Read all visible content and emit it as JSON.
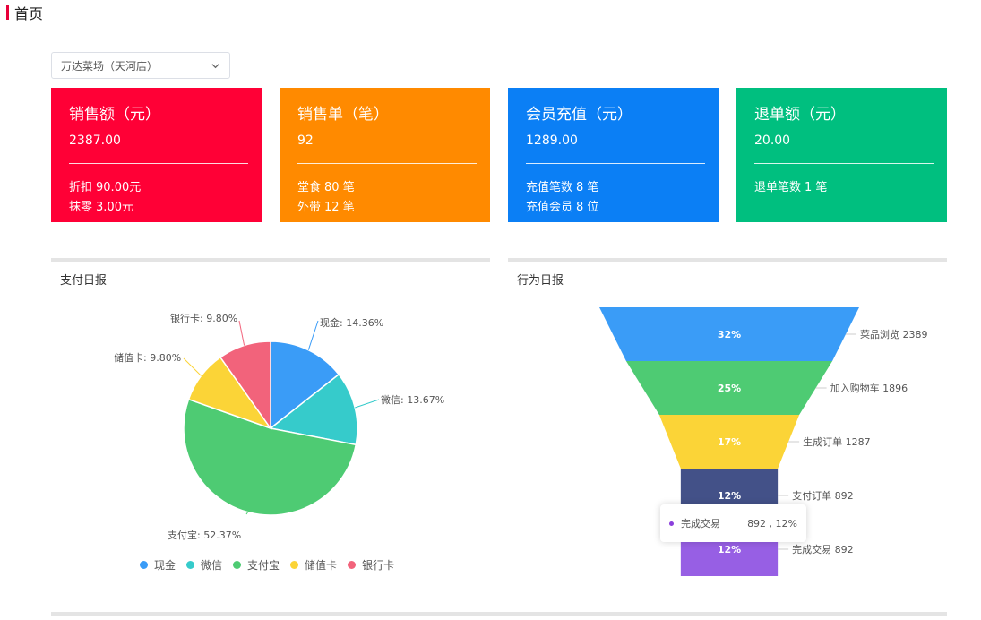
{
  "header": {
    "title": "首页"
  },
  "store_select": {
    "value": "万达菜场（天河店）",
    "icon": "chevron-down-icon"
  },
  "cards": [
    {
      "title": "销售额（元）",
      "value": "2387.00",
      "color": "#ff0036",
      "rows": [
        [
          "折扣",
          "90.00元"
        ],
        [
          "抹零",
          "3.00元"
        ]
      ]
    },
    {
      "title": "销售单（笔）",
      "value": "92",
      "color": "#ff8a00",
      "rows": [
        [
          "堂食",
          "80 笔"
        ],
        [
          "外带",
          "12 笔"
        ]
      ]
    },
    {
      "title": "会员充值（元）",
      "value": "1289.00",
      "color": "#0b7ff5",
      "rows": [
        [
          "充值笔数",
          "8 笔"
        ],
        [
          "充值会员",
          "8 位"
        ]
      ]
    },
    {
      "title": "退单额（元）",
      "value": "20.00",
      "color": "#00bf7f",
      "rows": [
        [
          "退单笔数",
          "1 笔"
        ]
      ]
    }
  ],
  "payment_panel": {
    "title": "支付日报"
  },
  "behavior_panel": {
    "title": "行为日报"
  },
  "chart_data": [
    {
      "type": "pie",
      "title": "支付日报",
      "legend_position": "bottom",
      "slices": [
        {
          "name": "现金",
          "percent": 14.36,
          "label": "现金: 14.36%",
          "color": "#3a9cf7"
        },
        {
          "name": "微信",
          "percent": 13.67,
          "label": "微信: 13.67%",
          "color": "#36cbcb"
        },
        {
          "name": "支付宝",
          "percent": 52.37,
          "label": "支付宝: 52.37%",
          "color": "#4ecb73"
        },
        {
          "name": "储值卡",
          "percent": 9.8,
          "label": "储值卡: 9.80%",
          "color": "#fbd437"
        },
        {
          "name": "银行卡",
          "percent": 9.8,
          "label": "银行卡: 9.80%",
          "color": "#f2637b"
        }
      ]
    },
    {
      "type": "funnel",
      "title": "行为日报",
      "stages": [
        {
          "name": "菜品浏览",
          "value": 2389,
          "percent": "32%",
          "label": "菜品浏览 2389",
          "color": "#3a9cf7"
        },
        {
          "name": "加入购物车",
          "value": 1896,
          "percent": "25%",
          "label": "加入购物车 1896",
          "color": "#4ecb73"
        },
        {
          "name": "生成订单",
          "value": 1287,
          "percent": "17%",
          "label": "生成订单 1287",
          "color": "#fbd437"
        },
        {
          "name": "支付订单",
          "value": 892,
          "percent": "12%",
          "label": "支付订单 892",
          "color": "#435188"
        },
        {
          "name": "完成交易",
          "value": 892,
          "percent": "12%",
          "label": "完成交易 892",
          "color": "#975fe4"
        }
      ],
      "tooltip": {
        "name": "完成交易",
        "value": "892 , 12%"
      }
    }
  ]
}
